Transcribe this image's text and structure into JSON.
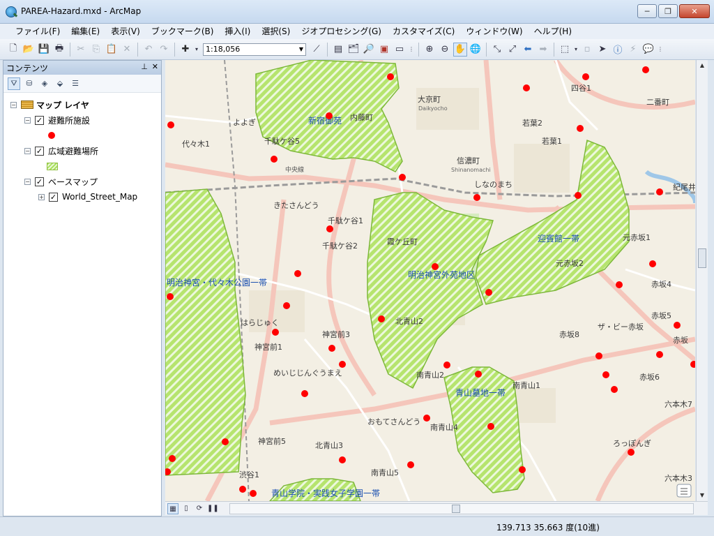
{
  "window": {
    "title": "PAREA-Hazard.mxd - ArcMap",
    "controls": [
      "─",
      "❐",
      "✕"
    ]
  },
  "menu": [
    "ファイル(F)",
    "編集(E)",
    "表示(V)",
    "ブックマーク(B)",
    "挿入(I)",
    "選択(S)",
    "ジオプロセシング(G)",
    "カスタマイズ(C)",
    "ウィンドウ(W)",
    "ヘルプ(H)"
  ],
  "toolbar": {
    "scale": "1:18,056"
  },
  "toc": {
    "title": "コンテンツ",
    "pin": "📌",
    "close": "✕",
    "root_label": "マップ レイヤ",
    "layers": [
      {
        "label": "避難所施設",
        "checked": true,
        "symbol": "red-dot"
      },
      {
        "label": "広域避難場所",
        "checked": true,
        "symbol": "green-hatch"
      },
      {
        "label": "ベースマップ",
        "checked": true,
        "symbol": "group"
      }
    ],
    "sublayer": {
      "label": "World_Street_Map",
      "checked": true
    },
    "check_mark": "✓",
    "minus": "−",
    "plus": "+"
  },
  "map": {
    "evacuation_areas": [
      {
        "name": "新宿御苑"
      },
      {
        "name": "明治神宮・代々木公園一帯"
      },
      {
        "name": "明治神宮外苑地区"
      },
      {
        "name": "迎賓館一帯"
      },
      {
        "name": "青山墓地一帯"
      },
      {
        "name": "青山学院・実践女子学園一帯"
      }
    ],
    "street_labels": [
      {
        "text": "大京町"
      },
      {
        "text": "Daikyocho"
      },
      {
        "text": "若葉2"
      },
      {
        "text": "若葉1"
      },
      {
        "text": "信濃町"
      },
      {
        "text": "Shinanomachi"
      },
      {
        "text": "四谷1"
      },
      {
        "text": "二番町"
      },
      {
        "text": "紀尾井"
      },
      {
        "text": "元赤坂1"
      },
      {
        "text": "元赤坂2"
      },
      {
        "text": "赤坂4"
      },
      {
        "text": "赤坂5"
      },
      {
        "text": "赤坂8"
      },
      {
        "text": "赤坂6"
      },
      {
        "text": "赤坂"
      },
      {
        "text": "六本木7"
      },
      {
        "text": "六本木3"
      },
      {
        "text": "南青山1"
      },
      {
        "text": "南青山2"
      },
      {
        "text": "南青山4"
      },
      {
        "text": "南青山5"
      },
      {
        "text": "北青山2"
      },
      {
        "text": "北青山3"
      },
      {
        "text": "神宮前3"
      },
      {
        "text": "神宮前1"
      },
      {
        "text": "神宮前5"
      },
      {
        "text": "千駄ケ谷1"
      },
      {
        "text": "千駄ケ谷2"
      },
      {
        "text": "千駄ケ谷5"
      },
      {
        "text": "代々木1"
      },
      {
        "text": "渋谷1"
      },
      {
        "text": "霞ケ丘町"
      },
      {
        "text": "内藤町"
      },
      {
        "text": "ろっぽんぎ"
      },
      {
        "text": "はらじゅく"
      },
      {
        "text": "おもてさんどう"
      },
      {
        "text": "きたさんどう"
      },
      {
        "text": "めいじじんぐうまえ"
      },
      {
        "text": "しなのまち"
      },
      {
        "text": "よよぎ"
      },
      {
        "text": "ザ・ビー赤坂"
      },
      {
        "text": "中央線"
      }
    ],
    "shelters_count": 48
  },
  "status": {
    "coordinates": "139.713  35.663 度(10進)"
  },
  "colors": {
    "shelter": "#ff0000",
    "area_fill": "#a9e05d",
    "area_stroke": "#7db83a",
    "road_major": "#f7c8bf",
    "park": "#cfe6b4"
  }
}
